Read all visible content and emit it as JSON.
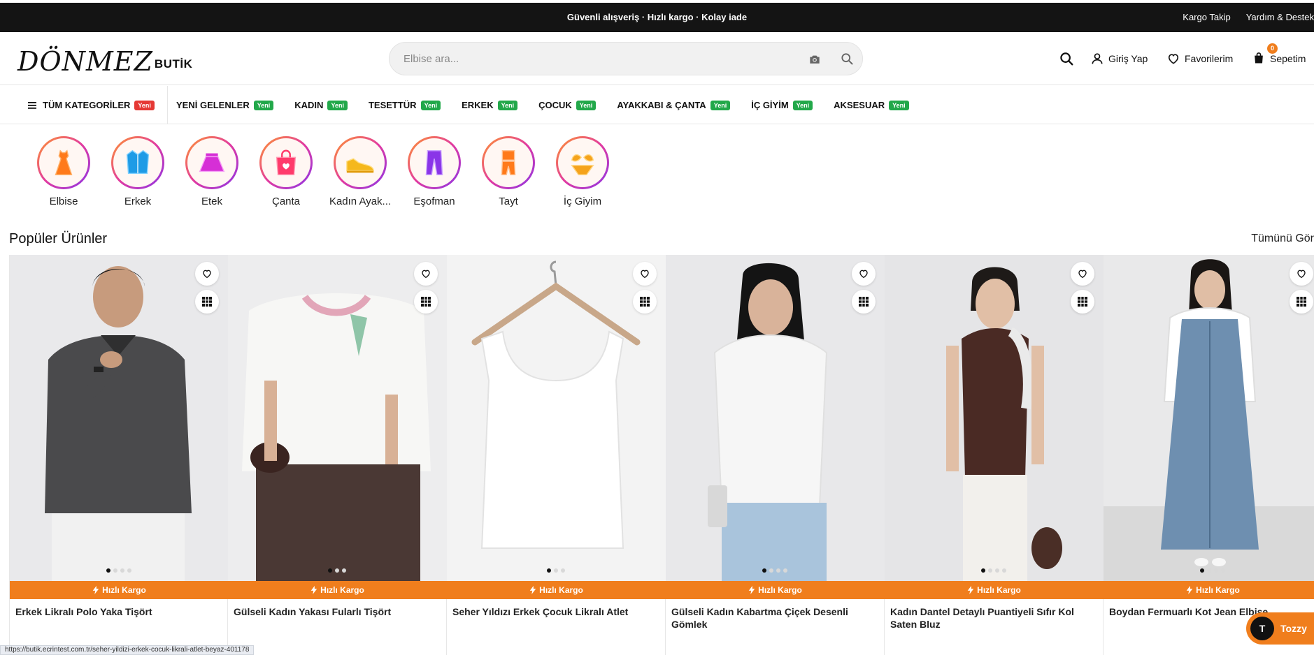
{
  "topbar": {
    "message": "Güvenli alışveriş · Hızlı kargo · Kolay iade",
    "links": [
      "Kargo Takip",
      "Yardım & Destek"
    ]
  },
  "header": {
    "logo_script": "DÖNMEZ",
    "logo_word": "BUTİK",
    "search_placeholder": "Elbise ara...",
    "login_label": "Giriş Yap",
    "favorites_label": "Favorilerim",
    "cart_label": "Sepetim",
    "cart_count": "0"
  },
  "nav": {
    "all_categories": "TÜM KATEGORİLER",
    "new_badge": "Yeni",
    "items": [
      {
        "label": "YENİ GELENLER",
        "badge": "Yeni"
      },
      {
        "label": "KADIN",
        "badge": "Yeni"
      },
      {
        "label": "TESETTÜR",
        "badge": "Yeni"
      },
      {
        "label": "ERKEK",
        "badge": "Yeni"
      },
      {
        "label": "ÇOCUK",
        "badge": "Yeni"
      },
      {
        "label": "AYAKKABI & ÇANTA",
        "badge": "Yeni"
      },
      {
        "label": "İÇ GİYİM",
        "badge": "Yeni"
      },
      {
        "label": "AKSESUAR",
        "badge": "Yeni"
      }
    ]
  },
  "categories": [
    {
      "label": "Elbise",
      "icon": "dress-icon",
      "color": "#ff7a1a"
    },
    {
      "label": "Erkek",
      "icon": "jacket-icon",
      "color": "#1e9be6"
    },
    {
      "label": "Etek",
      "icon": "skirt-icon",
      "color": "#d62fd6"
    },
    {
      "label": "Çanta",
      "icon": "bag-icon",
      "color": "#ff3b6b"
    },
    {
      "label": "Kadın Ayak...",
      "icon": "shoe-icon",
      "color": "#f5b81c"
    },
    {
      "label": "Eşofman",
      "icon": "pants-icon",
      "color": "#8a35e8"
    },
    {
      "label": "Tayt",
      "icon": "tracksuit-icon",
      "color": "#ff7a1a"
    },
    {
      "label": "İç Giyim",
      "icon": "bikini-icon",
      "color": "#f5a31c"
    }
  ],
  "popular": {
    "title": "Popüler Ürünler",
    "see_all": "Tümünü Gör",
    "fast_shipping": "Hızlı Kargo",
    "products": [
      {
        "name": "Erkek Likralı Polo Yaka Tişört",
        "image": "man-dark-polo",
        "dots": 4,
        "active_dot": 0
      },
      {
        "name": "Gülseli Kadın Yakası Fularlı Tişört",
        "image": "woman-white-tee",
        "dots": 3,
        "active_dot": 0
      },
      {
        "name": "Seher Yıldızı Erkek Çocuk Likralı Atlet",
        "image": "white-tank-hanger",
        "dots": 3,
        "active_dot": 0
      },
      {
        "name": "Gülseli Kadın Kabartma Çiçek Desenli Gömlek",
        "image": "woman-white-shirt",
        "dots": 4,
        "active_dot": 0
      },
      {
        "name": "Kadın Dantel Detaylı Puantiyeli Sıfır Kol Saten Bluz",
        "image": "woman-brown-blouse",
        "dots": 4,
        "active_dot": 0
      },
      {
        "name": "Boydan Fermuarlı Kot Jean Elbise",
        "image": "woman-denim-dress",
        "dots": 4,
        "active_dot": 0
      }
    ]
  },
  "status_url": "https://butik.ecrintest.com.tr/seher-yildizi-erkek-cocuk-likrali-atlet-beyaz-401178",
  "chat": {
    "label": "Tozzy",
    "avatar": "T"
  }
}
